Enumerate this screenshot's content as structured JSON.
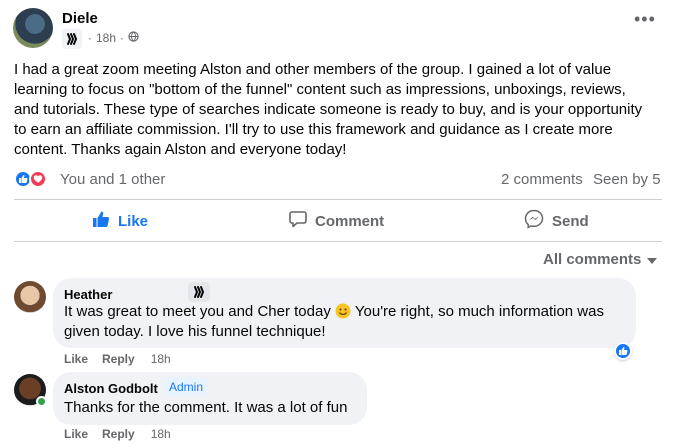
{
  "post": {
    "author": "Diele",
    "time": "18h",
    "privacy_icon": "globe-icon",
    "body": "I had a great zoom meeting Alston and other members of the group. I gained a lot of value learning to focus on \"bottom of the funnel\" content such as impressions, unboxings, reviews, and tutorials. These type of searches indicate someone is ready to buy, and is your opportunity to earn an affiliate commission. I'll try to use this framework and guidance as I create more content. Thanks again Alston and everyone today!",
    "reactions_text": "You and 1 other",
    "comments_count": "2 comments",
    "seen_by": "Seen by 5",
    "more_icon": "•••"
  },
  "actions": {
    "like": "Like",
    "comment": "Comment",
    "send": "Send"
  },
  "all_comments_label": "All comments",
  "comments": [
    {
      "author": "Heather",
      "text_before_emoji": "It was great to meet you and Cher today ",
      "text_after_emoji": " You're right, so much information was given today. I love his funnel technique!",
      "like": "Like",
      "reply": "Reply",
      "time": "18h"
    },
    {
      "author": "Alston Godbolt",
      "role": "Admin",
      "text": "Thanks for the comment. It was a lot of fun",
      "like": "Like",
      "reply": "Reply",
      "time": "18h"
    }
  ],
  "colors": {
    "accent": "#1877f2",
    "secondary_text": "#65676b",
    "bubble": "#f0f2f5",
    "love": "#f33e58",
    "online": "#31a24c"
  }
}
